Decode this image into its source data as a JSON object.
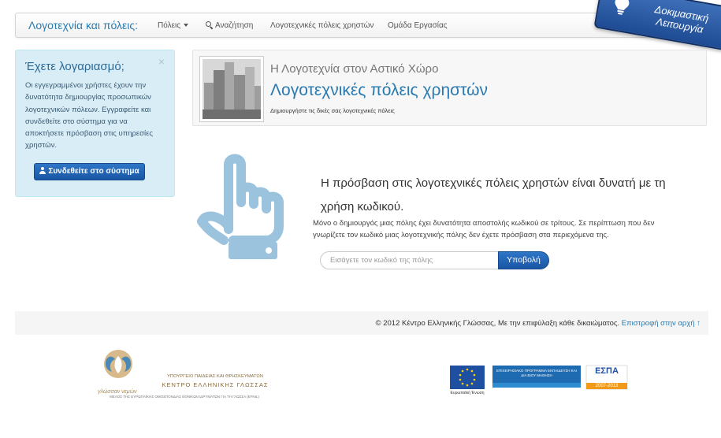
{
  "navbar": {
    "brand": "Λογοτεχνία και πόλεις:",
    "items": [
      {
        "label": "Πόλεις",
        "icon": "caret-down"
      },
      {
        "label": "Αναζήτηση",
        "icon": "search-icon"
      },
      {
        "label": "Λογοτεχνικές πόλεις χρηστών"
      },
      {
        "label": "Ομάδα Εργασίας"
      }
    ]
  },
  "beta_badge": {
    "line1": "Δοκιμαστική",
    "line2": "Λειτουργία"
  },
  "login": {
    "title": "Έχετε λογαριασμό;",
    "close": "×",
    "text": "Οι εγγεγραμμένοι χρήστες έχουν την δυνατότητα δημιουργίας προσωπικών λογοτεχνικών πόλεων. Εγγραφείτε και συνδεθείτε στο σύστημα για να αποκτήσετε πρόσβαση στις υπηρεσίες χρηστών.",
    "button": "Συνδεθείτε στο σύστημα"
  },
  "hero": {
    "subtitle": "Η Λογοτεχνία στον Αστικό Χώρο",
    "title": "Λογοτεχνικές πόλεις χρηστών",
    "small": "Δημιουργήστε τις δικές σας λογοτεχνικές πόλεις"
  },
  "access": {
    "title": "Η πρόσβαση στις λογοτεχνικές πόλεις χρηστών είναι δυνατή με τη χρήση κωδικού.",
    "text": "Μόνο ο δημιουργός μιας πόλης έχει δυνατότητα αποστολής κωδικού σε τρίτους. Σε περίπτωση που δεν γνωρίζετε τον κωδικό μιας λογοτεχνικής πόλης δεν έχετε πρόσβαση στα περιεχόμενα της.",
    "input_placeholder": "Εισάγετε τον κωδικό της πόλης",
    "submit": "Υποβολή"
  },
  "footer": {
    "copyright": "© 2012 Κέντρο Ελληνικής Γλώσσας, Με την επιφύλαξη κάθε δικαιώματος.",
    "back_to_top": "Επιστροφή στην αρχή ↑"
  },
  "logos": {
    "ministry": "ΥΠΟΥΡΓΕΙΟ ΠΑΙΔΕΙΑΣ ΚΑΙ ΘΡΗΣΚΕΥΜΑΤΩΝ",
    "center": "ΚΕΝΤΡΟ ΕΛΛΗΝΙΚΗΣ ΓΛΩΣΣΑΣ",
    "member": "ΜΕΛΟΣ ΤΗΣ ΕΥΡΩΠΑΪΚΗΣ ΟΜΟΣΠΟΝΔΙΑΣ ΕΘΝΙΚΩΝ ΙΔΡΥΜΑΤΩΝ ΓΙΑ ΤΗ ΓΛΩΣΣΑ (EFNIL)",
    "script": "γλώσσαν νεμών",
    "eu": "Ευρωπαϊκή Ένωση",
    "espa": "ΕΣΠΑ",
    "espa_years": "2007-2013",
    "program": "ΕΠΙΧΕΙΡΗΣΙΑΚΟ ΠΡΟΓΡΑΜΜΑ ΕΚΠΑΙΔΕΥΣΗ ΚΑΙ ΔΙΑ ΒΙΟΥ ΜΑΘΗΣΗ"
  }
}
